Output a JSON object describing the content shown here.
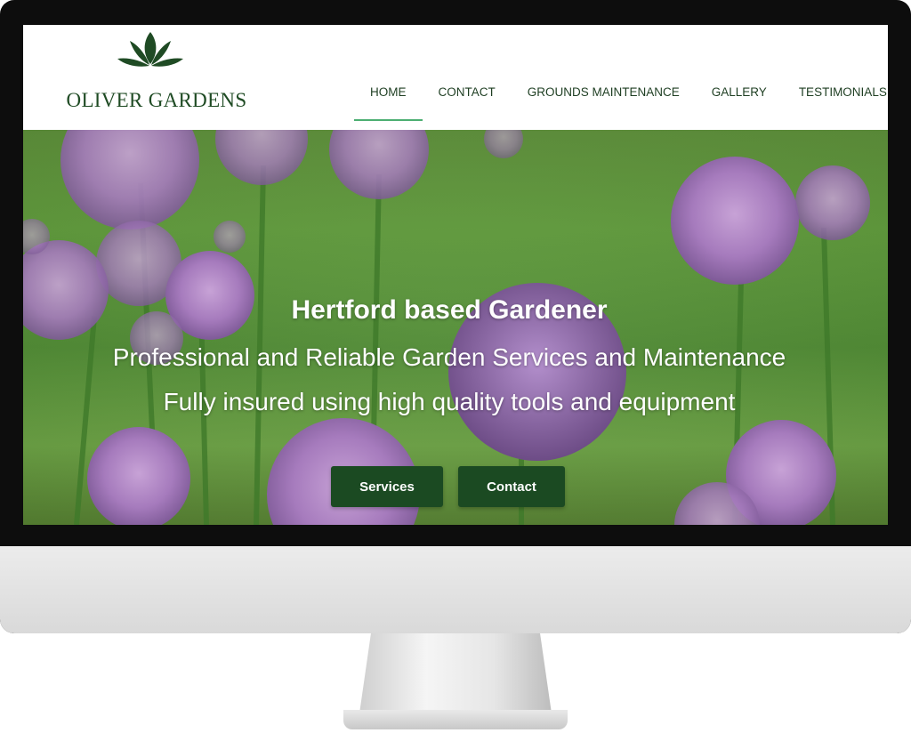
{
  "brand": {
    "name": "OLIVER GARDENS",
    "logo_icon": "lotus-leaf-icon",
    "color": "#1f4b24"
  },
  "nav": {
    "items": [
      {
        "label": "HOME",
        "active": true
      },
      {
        "label": "CONTACT",
        "active": false
      },
      {
        "label": "GROUNDS MAINTENANCE",
        "active": false
      },
      {
        "label": "GALLERY",
        "active": false
      },
      {
        "label": "TESTIMONIALS",
        "active": false
      }
    ],
    "active_underline_color": "#4caf72"
  },
  "hero": {
    "title": "Hertford based Gardener",
    "subtitle": "Professional and Reliable Garden Services and Maintenance",
    "tagline": "Fully insured using high quality tools and equipment",
    "buttons": {
      "services": "Services",
      "contact": "Contact"
    },
    "button_color": "#1b4a22"
  }
}
